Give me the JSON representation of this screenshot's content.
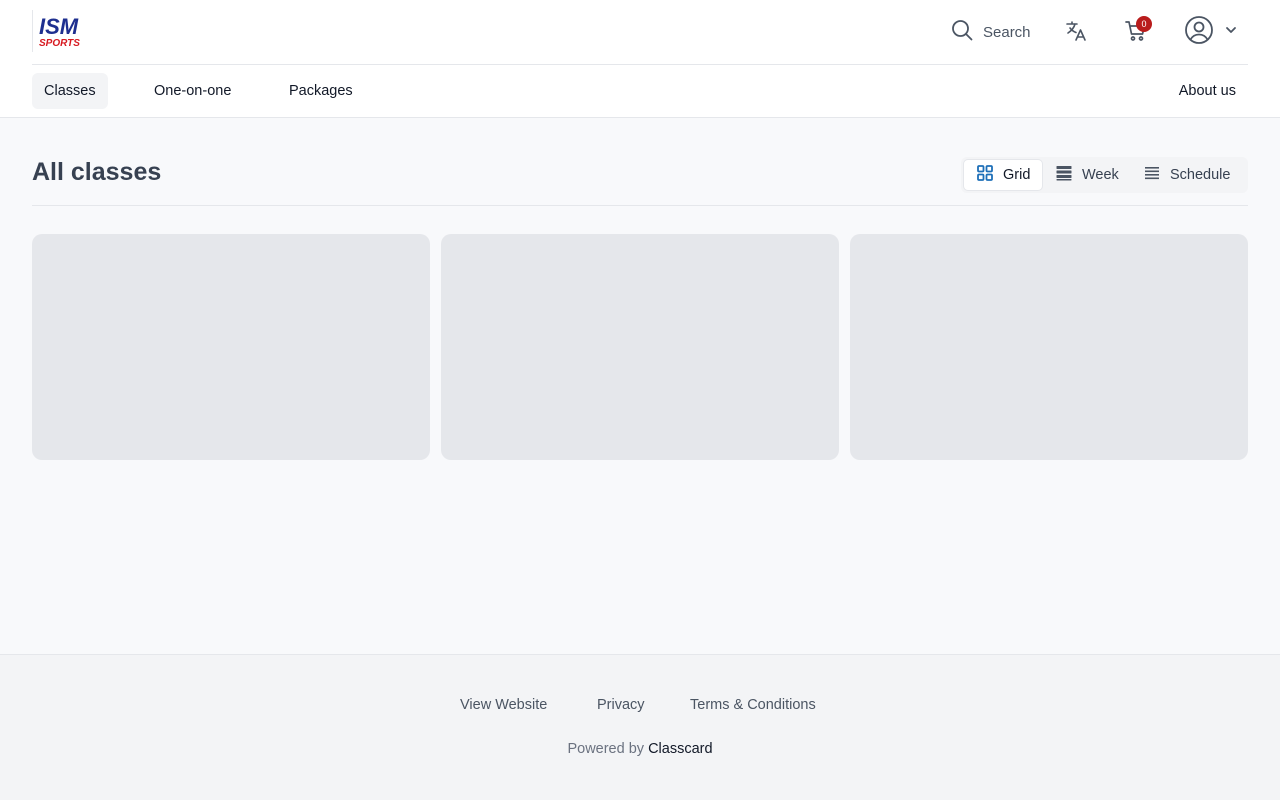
{
  "header": {
    "logo_text": "ISM SPORTS",
    "search_label": "Search",
    "cart_count": "0"
  },
  "nav": {
    "items": [
      {
        "label": "Classes",
        "active": true
      },
      {
        "label": "One-on-one",
        "active": false
      },
      {
        "label": "Packages",
        "active": false
      }
    ],
    "about_label": "About us"
  },
  "main": {
    "title": "All classes",
    "views": [
      {
        "label": "Grid",
        "icon": "grid-icon",
        "active": true
      },
      {
        "label": "Week",
        "icon": "week-icon",
        "active": false
      },
      {
        "label": "Schedule",
        "icon": "schedule-icon",
        "active": false
      }
    ],
    "placeholder_cards": 3
  },
  "footer": {
    "links": [
      {
        "label": "View Website"
      },
      {
        "label": "Privacy"
      },
      {
        "label": "Terms & Conditions"
      }
    ],
    "powered_prefix": "Powered by",
    "powered_brand": "Classcard"
  },
  "colors": {
    "accent": "#1d6fb8",
    "badge": "#b91c1c",
    "logo_blue": "#1e2f8f",
    "logo_red": "#d71920"
  }
}
